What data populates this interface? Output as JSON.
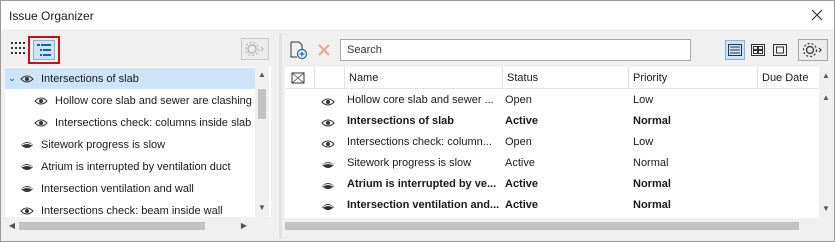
{
  "window": {
    "title": "Issue Organizer"
  },
  "left_panel": {
    "items": [
      {
        "label": "Intersections of slab",
        "level": 0,
        "selected": true,
        "expanded": true,
        "eye": "eye-open"
      },
      {
        "label": "Hollow core slab and sewer are clashing",
        "level": 1,
        "selected": false,
        "eye": "eye-open"
      },
      {
        "label": "Intersections check: columns inside slab",
        "level": 1,
        "selected": false,
        "eye": "eye-open"
      },
      {
        "label": "Sitework progress is slow",
        "level": 0,
        "selected": false,
        "eye": "eye-closed"
      },
      {
        "label": "Atrium is interrupted by ventilation duct",
        "level": 0,
        "selected": false,
        "eye": "eye-closed"
      },
      {
        "label": "Intersection ventilation and wall",
        "level": 0,
        "selected": false,
        "eye": "eye-closed"
      },
      {
        "label": "Intersections check: beam inside wall",
        "level": 0,
        "selected": false,
        "eye": "eye-open"
      }
    ]
  },
  "right_panel": {
    "search": {
      "placeholder": "Search"
    },
    "columns": [
      "Name",
      "Status",
      "Priority",
      "Due Date"
    ],
    "rows": [
      {
        "name": "Hollow core slab and sewer ...",
        "status": "Open",
        "priority": "Low",
        "bold": false,
        "eye": "eye-open"
      },
      {
        "name": "Intersections of slab",
        "status": "Active",
        "priority": "Normal",
        "bold": true,
        "eye": "eye-open"
      },
      {
        "name": "Intersections check: column...",
        "status": "Open",
        "priority": "Low",
        "bold": false,
        "eye": "eye-open"
      },
      {
        "name": "Sitework progress is slow",
        "status": "Active",
        "priority": "Normal",
        "bold": false,
        "eye": "eye-closed"
      },
      {
        "name": "Atrium is interrupted by ve...",
        "status": "Active",
        "priority": "Normal",
        "bold": true,
        "eye": "eye-closed"
      },
      {
        "name": "Intersection ventilation and...",
        "status": "Active",
        "priority": "Normal",
        "bold": true,
        "eye": "eye-closed"
      }
    ]
  },
  "colors": {
    "selection": "#cde3f7",
    "highlight_border": "#c0131a",
    "delete_icon": "#f4a18a",
    "active_view": "#cce4f7"
  }
}
